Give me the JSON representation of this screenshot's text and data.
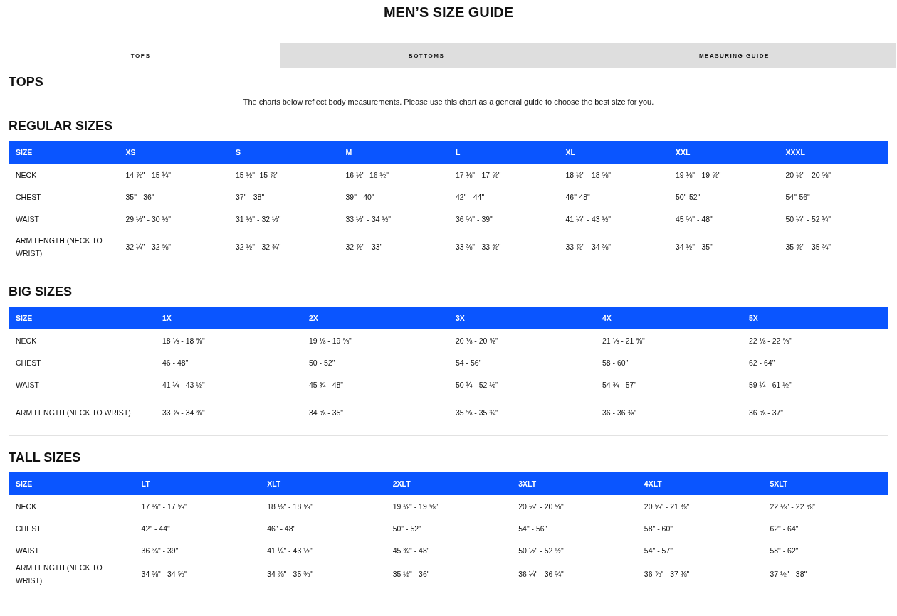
{
  "title": "MEN’S SIZE GUIDE",
  "tabs": [
    {
      "label": "TOPS",
      "selected": true
    },
    {
      "label": "BOTTOMS",
      "selected": false
    },
    {
      "label": "MEASURING GUIDE",
      "selected": false
    }
  ],
  "section_title": "TOPS",
  "intro": "The charts below reflect body measurements. Please use this chart as a general guide to choose the best size for you.",
  "tables": [
    {
      "title": "REGULAR SIZES",
      "columns": [
        "SIZE",
        "XS",
        "S",
        "M",
        "L",
        "XL",
        "XXL",
        "XXXL"
      ],
      "rows": [
        [
          "NECK",
          "14 ⅞\" - 15 ¼\"",
          "15 ½\" -15 ⅞\"",
          "16 ⅛\" -16 ½\"",
          "17 ⅛\" - 17 ⅝\"",
          "18 ⅛\" - 18 ⅝\"",
          "19 ⅛\" - 19 ⅝\"",
          "20 ⅛\" - 20 ⅝\""
        ],
        [
          "CHEST",
          "35\" - 36\"",
          "37\" - 38\"",
          "39\" - 40\"",
          "42\" - 44\"",
          "46\"-48\"",
          "50\"-52\"",
          "54\"-56\""
        ],
        [
          "WAIST",
          "29 ½\" - 30 ½\"",
          "31 ½\" - 32 ½\"",
          "33 ½\" - 34 ½\"",
          "36 ¾\" - 39\"",
          "41 ¼\" - 43 ½\"",
          "45 ¾\" - 48\"",
          "50 ¼\" - 52 ¼\""
        ],
        [
          "ARM LENGTH (NECK TO WRIST)",
          "32 ¼\" - 32 ⅝\"",
          "32 ½\" - 32 ¾\"",
          "32 ⅞\" - 33\"",
          "33 ⅜\" - 33 ⅝\"",
          "33 ⅞\" - 34 ⅜\"",
          "34 ½\" - 35\"",
          "35 ⅝\" - 35 ¾\""
        ]
      ]
    },
    {
      "title": "BIG SIZES",
      "columns": [
        "SIZE",
        "1X",
        "2X",
        "3X",
        "4X",
        "5X"
      ],
      "rows": [
        [
          "NECK",
          "18 ⅛ - 18 ⅝\"",
          "19 ⅛ - 19 ⅝\"",
          "20 ⅛ - 20 ⅝\"",
          "21 ⅛ - 21 ⅝\"",
          "22 ⅛ - 22 ⅝\""
        ],
        [
          "CHEST",
          "46 - 48\"",
          "50 - 52\"",
          "54 - 56\"",
          "58 - 60\"",
          "62 - 64\""
        ],
        [
          "WAIST",
          "41 ¼ - 43 ½\"",
          "45 ¾ - 48\"",
          "50 ¼ - 52 ½\"",
          "54 ¾ - 57\"",
          "59 ¼ - 61 ½\""
        ],
        [
          "ARM LENGTH (NECK TO WRIST)",
          "33 ⅞ - 34 ⅜\"",
          "34 ⅝ - 35\"",
          "35 ⅝ - 35 ¾\"",
          "36 - 36 ⅜\"",
          "36 ⅝ - 37\""
        ]
      ]
    },
    {
      "title": "TALL SIZES",
      "columns": [
        "SIZE",
        "LT",
        "XLT",
        "2XLT",
        "3XLT",
        "4XLT",
        "5XLT"
      ],
      "rows": [
        [
          "NECK",
          "17 ⅛\" - 17 ⅝\"",
          "18 ⅛\" - 18 ⅝\"",
          "19 ⅛\" - 19 ⅝\"",
          "20 ⅛\" - 20 ⅝\"",
          "20 ⅝\" - 21 ⅜\"",
          "22 ⅛\" - 22 ⅝\""
        ],
        [
          "CHEST",
          "42\" - 44\"",
          "46\" - 48\"",
          "50\" - 52\"",
          "54\" - 56\"",
          "58\" - 60\"",
          "62\" - 64\""
        ],
        [
          "WAIST",
          "36 ¾\" - 39\"",
          "41 ¼\" - 43 ½\"",
          "45 ¾\" - 48\"",
          "50 ½\" - 52 ½\"",
          "54\" - 57\"",
          "58\" - 62\""
        ],
        [
          "ARM LENGTH (NECK TO WRIST)",
          "34 ⅜\" - 34 ⅝\"",
          "34 ⅞\" - 35 ⅜\"",
          "35 ½\" - 36\"",
          "36 ¼\" - 36 ¾\"",
          "36 ⅞\" - 37 ⅜\"",
          "37 ½\" - 38\""
        ]
      ]
    }
  ]
}
